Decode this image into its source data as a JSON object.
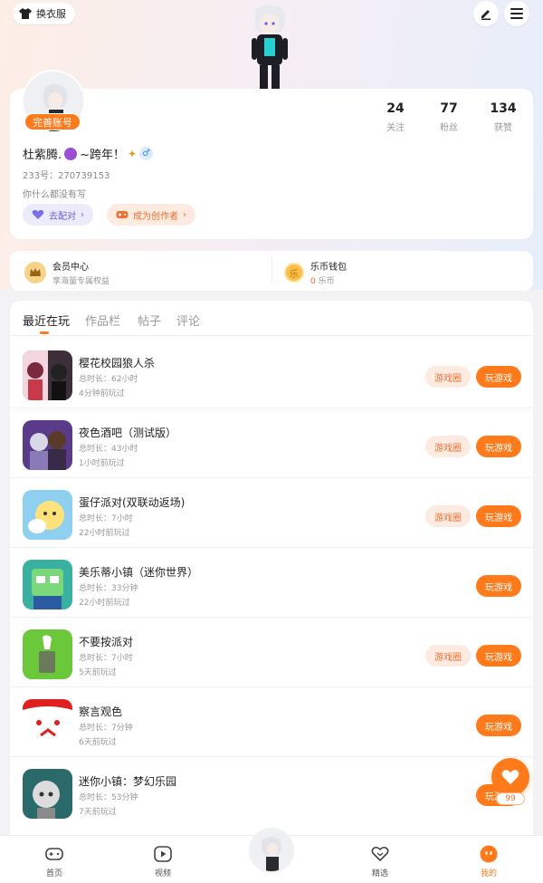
{
  "topbar": {
    "wardrobe_label": "换衣服"
  },
  "profile": {
    "complete_label": "完善账号",
    "nickname": "杜紫腾.",
    "nickname_suffix": "~跨年！",
    "uid": "233号：270739153",
    "bio": "你什么都没有写",
    "stats": [
      {
        "value": "24",
        "label": "关注"
      },
      {
        "value": "77",
        "label": "粉丝"
      },
      {
        "value": "134",
        "label": "获赞"
      }
    ],
    "match_label": "去配对",
    "creator_label": "成为创作者"
  },
  "wallet": {
    "vip_title": "会员中心",
    "vip_sub": "享海量专属权益",
    "coin_title": "乐币钱包",
    "coin_value": "0",
    "coin_unit": "乐币",
    "coin_glyph": "乐"
  },
  "tabs": [
    "最近在玩",
    "作品栏",
    "帖子",
    "评论"
  ],
  "games": [
    {
      "name": "樱花校园狼人杀",
      "time": "总时长：62小时",
      "last": "4分钟前玩过",
      "circle": true
    },
    {
      "name": "夜色酒吧（测试版）",
      "time": "总时长：43小时",
      "last": "1小时前玩过",
      "circle": true
    },
    {
      "name": "蛋仔派对(双联动返场)",
      "time": "总时长：7小时",
      "last": "22小时前玩过",
      "circle": true
    },
    {
      "name": "美乐蒂小镇（迷你世界）",
      "time": "总时长：33分钟",
      "last": "22小时前玩过",
      "circle": false
    },
    {
      "name": "不要按派对",
      "time": "总时长：7小时",
      "last": "5天前玩过",
      "circle": true
    },
    {
      "name": "察言观色",
      "time": "总时长：7分钟",
      "last": "6天前玩过",
      "circle": false
    },
    {
      "name": "迷你小镇：梦幻乐园",
      "time": "总时长：53分钟",
      "last": "7天前玩过",
      "circle": false
    }
  ],
  "buttons": {
    "circle_label": "游戏圈",
    "play_label": "玩游戏"
  },
  "float": {
    "count": "99"
  },
  "nav": [
    {
      "label": "首页"
    },
    {
      "label": "视频"
    },
    {
      "label": "精选"
    },
    {
      "label": "我的"
    }
  ],
  "colors": {
    "accent": "#ff7a1a",
    "accent_light": "#fdebe1",
    "purple": "#6a5fd6"
  }
}
